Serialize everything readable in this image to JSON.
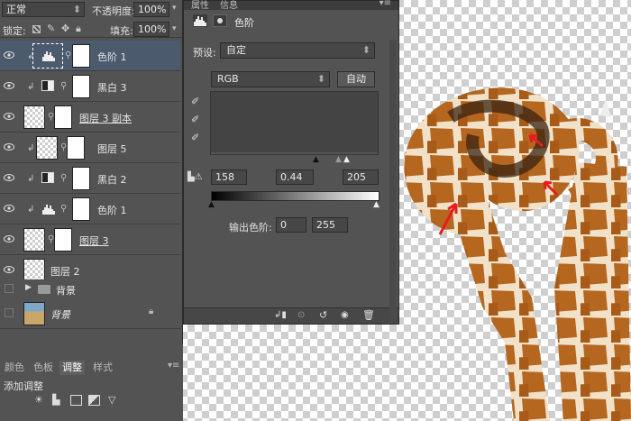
{
  "layers_panel": {
    "blend_mode": "正常",
    "opacity_label": "不透明度:",
    "opacity_value": "100%",
    "lock_label": "锁定:",
    "fill_label": "填充:",
    "fill_value": "100%",
    "layers": [
      {
        "name": "色阶 1",
        "type": "levels",
        "selected": true
      },
      {
        "name": "黑白 3",
        "type": "bw"
      },
      {
        "name": "图层 3 副本",
        "type": "pixel",
        "underline": true
      },
      {
        "name": "图层 5",
        "type": "pixel"
      },
      {
        "name": "黑白 2",
        "type": "bw"
      },
      {
        "name": "色阶 1",
        "type": "levels"
      },
      {
        "name": "图层 3",
        "type": "pixel",
        "underline": true
      },
      {
        "name": "图层 2",
        "type": "pixel"
      },
      {
        "name": "背景",
        "type": "group"
      },
      {
        "name": "背景",
        "type": "background"
      }
    ]
  },
  "properties": {
    "tab_properties": "属性",
    "tab_info": "信息",
    "title": "色阶",
    "preset_label": "预设:",
    "preset_value": "自定",
    "channel_value": "RGB",
    "auto_label": "自动",
    "input_black": "158",
    "input_gamma": "0.44",
    "input_white": "205",
    "output_label": "输出色阶:",
    "output_black": "0",
    "output_white": "255"
  },
  "bottom_panel": {
    "tabs": [
      "颜色",
      "色板",
      "调整",
      "样式"
    ],
    "active_tab": "调整",
    "add_adjustment": "添加调整"
  },
  "colors": {
    "panel_bg": "#535353",
    "selected_layer": "#4b5a6c",
    "annotation_arrow": "#e81c1c"
  }
}
